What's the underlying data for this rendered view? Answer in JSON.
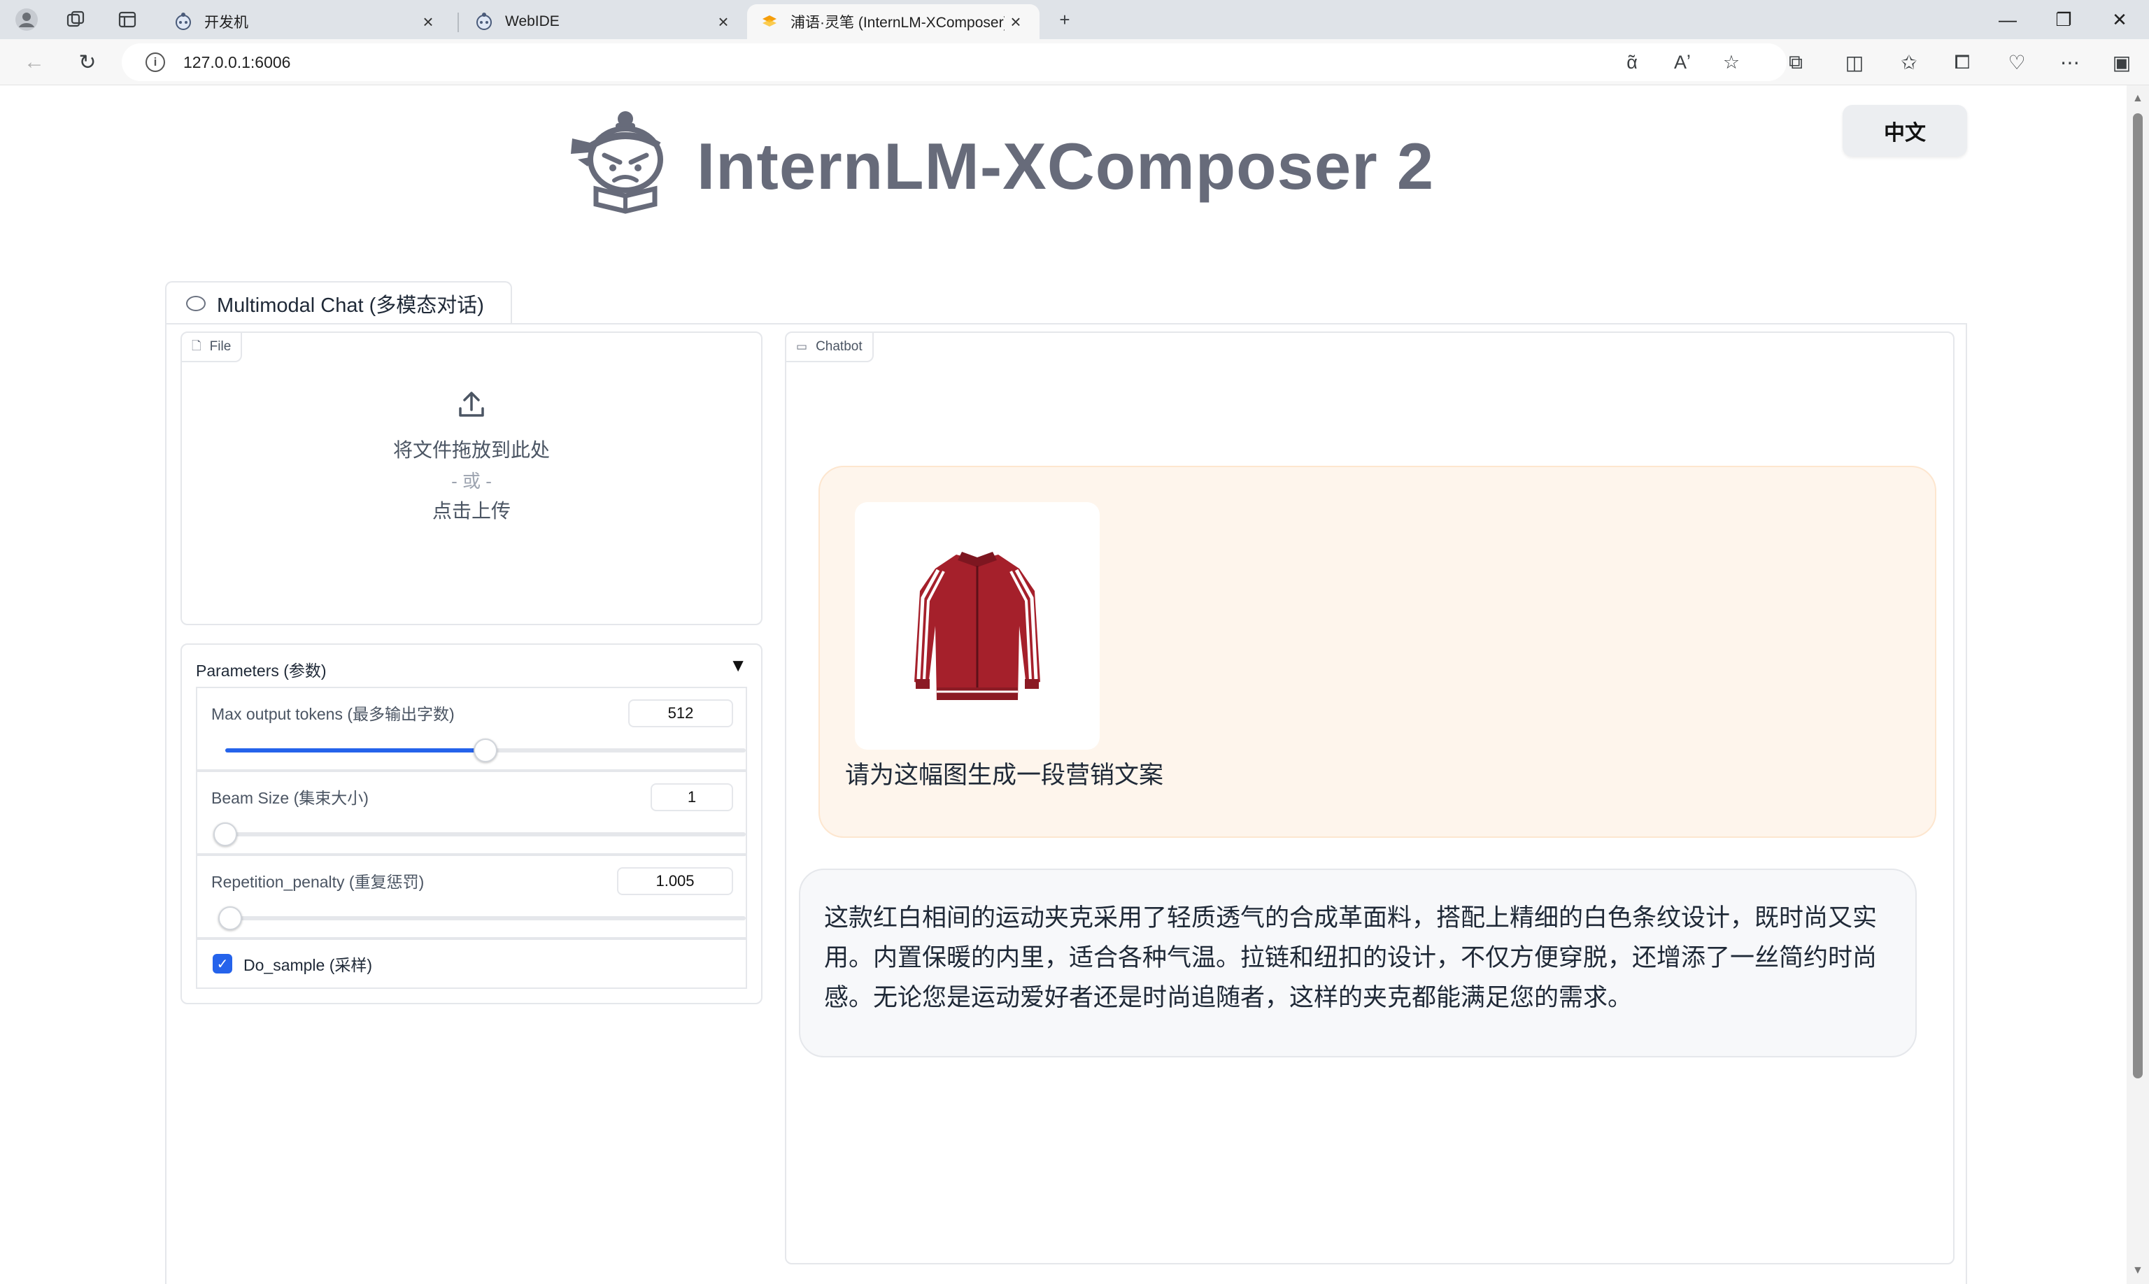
{
  "browser": {
    "tabs": [
      {
        "title": "开发机",
        "favicon": "robot-icon"
      },
      {
        "title": "WebIDE",
        "favicon": "robot-icon"
      },
      {
        "title": "浦语·灵笔 (InternLM-XComposer)",
        "favicon": "gradio-icon",
        "active": true
      }
    ],
    "url": "127.0.0.1:6006"
  },
  "page": {
    "lang_button": "中文",
    "title": "InternLM-XComposer 2",
    "tab_label": "Multimodal Chat (多模态对话)"
  },
  "file_block": {
    "label": "File",
    "drop_text": "将文件拖放到此处",
    "or_text": "- 或 -",
    "click_text": "点击上传"
  },
  "params": {
    "title": "Parameters (参数)",
    "toggle": "▼",
    "max_tokens": {
      "label": "Max output tokens (最多输出字数)",
      "value": "512",
      "fraction": 0.5
    },
    "beam": {
      "label": "Beam Size (集束大小)",
      "value": "1",
      "fraction": 0
    },
    "repetition": {
      "label": "Repetition_penalty (重复惩罚)",
      "value": "1.005",
      "fraction": 0.01
    },
    "do_sample": {
      "label": "Do_sample (采样)",
      "checked": true
    }
  },
  "chatbot": {
    "label": "Chatbot",
    "user_message": "请为这幅图生成一段营销文案",
    "bot_message": "这款红白相间的运动夹克采用了轻质透气的合成革面料，搭配上精细的白色条纹设计，既时尚又实用。内置保暖的内里，适合各种气温。拉链和纽扣的设计，不仅方便穿脱，还增添了一丝简约时尚感。无论您是运动爱好者还是时尚追随者，这样的夹克都能满足您的需求。"
  },
  "colors": {
    "accent": "#2563eb",
    "user_bubble": "#fef5ec",
    "title_gray": "#676b7a",
    "jacket_red": "#a5202b"
  }
}
